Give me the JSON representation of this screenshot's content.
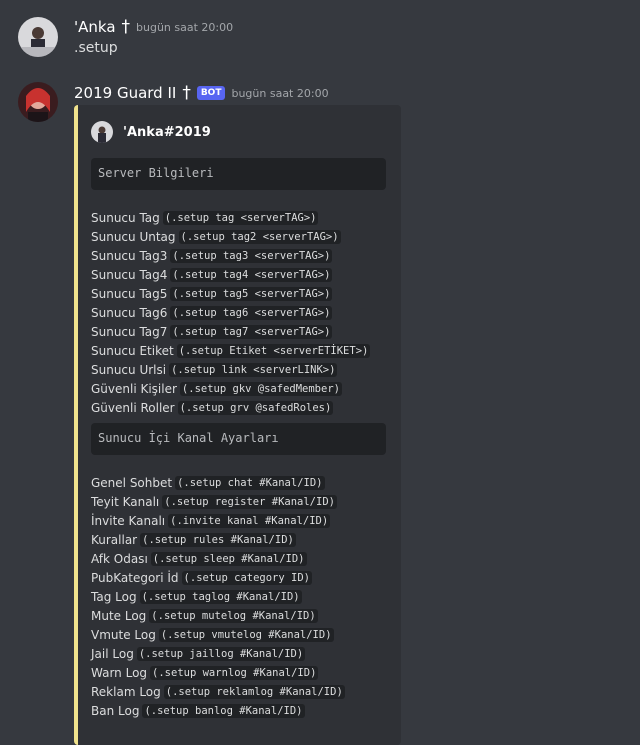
{
  "messages": [
    {
      "author": "'Anka",
      "author_suffix": "†",
      "timestamp": "bugün saat 20:00",
      "content": ".setup"
    },
    {
      "author": "2019 Guard II",
      "author_suffix": "†",
      "bot_tag": "BOT",
      "timestamp": "bugün saat 20:00",
      "embed": {
        "accent_color": "#f1e38d",
        "author": "'Anka#2019",
        "section1_title": "Server Bilgileri",
        "section1_rows": [
          {
            "label": "Sunucu Tag",
            "code": "(.setup tag <serverTAG>)"
          },
          {
            "label": "Sunucu Untag",
            "code": "(.setup tag2 <serverTAG>)"
          },
          {
            "label": "Sunucu Tag3",
            "code": "(.setup tag3 <serverTAG>)"
          },
          {
            "label": "Sunucu Tag4",
            "code": "(.setup tag4 <serverTAG>)"
          },
          {
            "label": "Sunucu Tag5",
            "code": "(.setup tag5 <serverTAG>)"
          },
          {
            "label": "Sunucu Tag6",
            "code": "(.setup tag6 <serverTAG>)"
          },
          {
            "label": "Sunucu Tag7",
            "code": "(.setup tag7 <serverTAG>)"
          },
          {
            "label": "Sunucu Etiket",
            "code": "(.setup Etiket <serverETİKET>)"
          },
          {
            "label": "Sunucu Urlsi",
            "code": "(.setup link <serverLINK>)"
          },
          {
            "label": "Güvenli Kişiler",
            "code": "(.setup gkv @safedMember)"
          },
          {
            "label": "Güvenli Roller",
            "code": "(.setup grv @safedRoles)"
          }
        ],
        "section2_title": "Sunucu İçi Kanal Ayarları",
        "section2_rows": [
          {
            "label": "Genel Sohbet",
            "code": "(.setup chat #Kanal/ID)"
          },
          {
            "label": "Teyit Kanalı",
            "code": "(.setup register #Kanal/ID)"
          },
          {
            "label": "İnvite Kanalı",
            "code": "(.invite kanal #Kanal/ID)"
          },
          {
            "label": "Kurallar",
            "code": "(.setup rules #Kanal/ID)"
          },
          {
            "label": "Afk Odası",
            "code": "(.setup sleep #Kanal/ID)"
          },
          {
            "label": "PubKategori İd",
            "code": "(.setup category ID)"
          },
          {
            "label": "Tag Log",
            "code": "(.setup taglog #Kanal/ID)"
          },
          {
            "label": "Mute Log",
            "code": "(.setup mutelog #Kanal/ID)"
          },
          {
            "label": "Vmute Log",
            "code": "(.setup vmutelog #Kanal/ID)"
          },
          {
            "label": "Jail Log",
            "code": "(.setup jaillog #Kanal/ID)"
          },
          {
            "label": "Warn Log",
            "code": "(.setup warnlog #Kanal/ID)"
          },
          {
            "label": "Reklam Log",
            "code": "(.setup reklamlog #Kanal/ID)"
          },
          {
            "label": "Ban Log",
            "code": "(.setup banlog #Kanal/ID)"
          }
        ]
      }
    }
  ]
}
